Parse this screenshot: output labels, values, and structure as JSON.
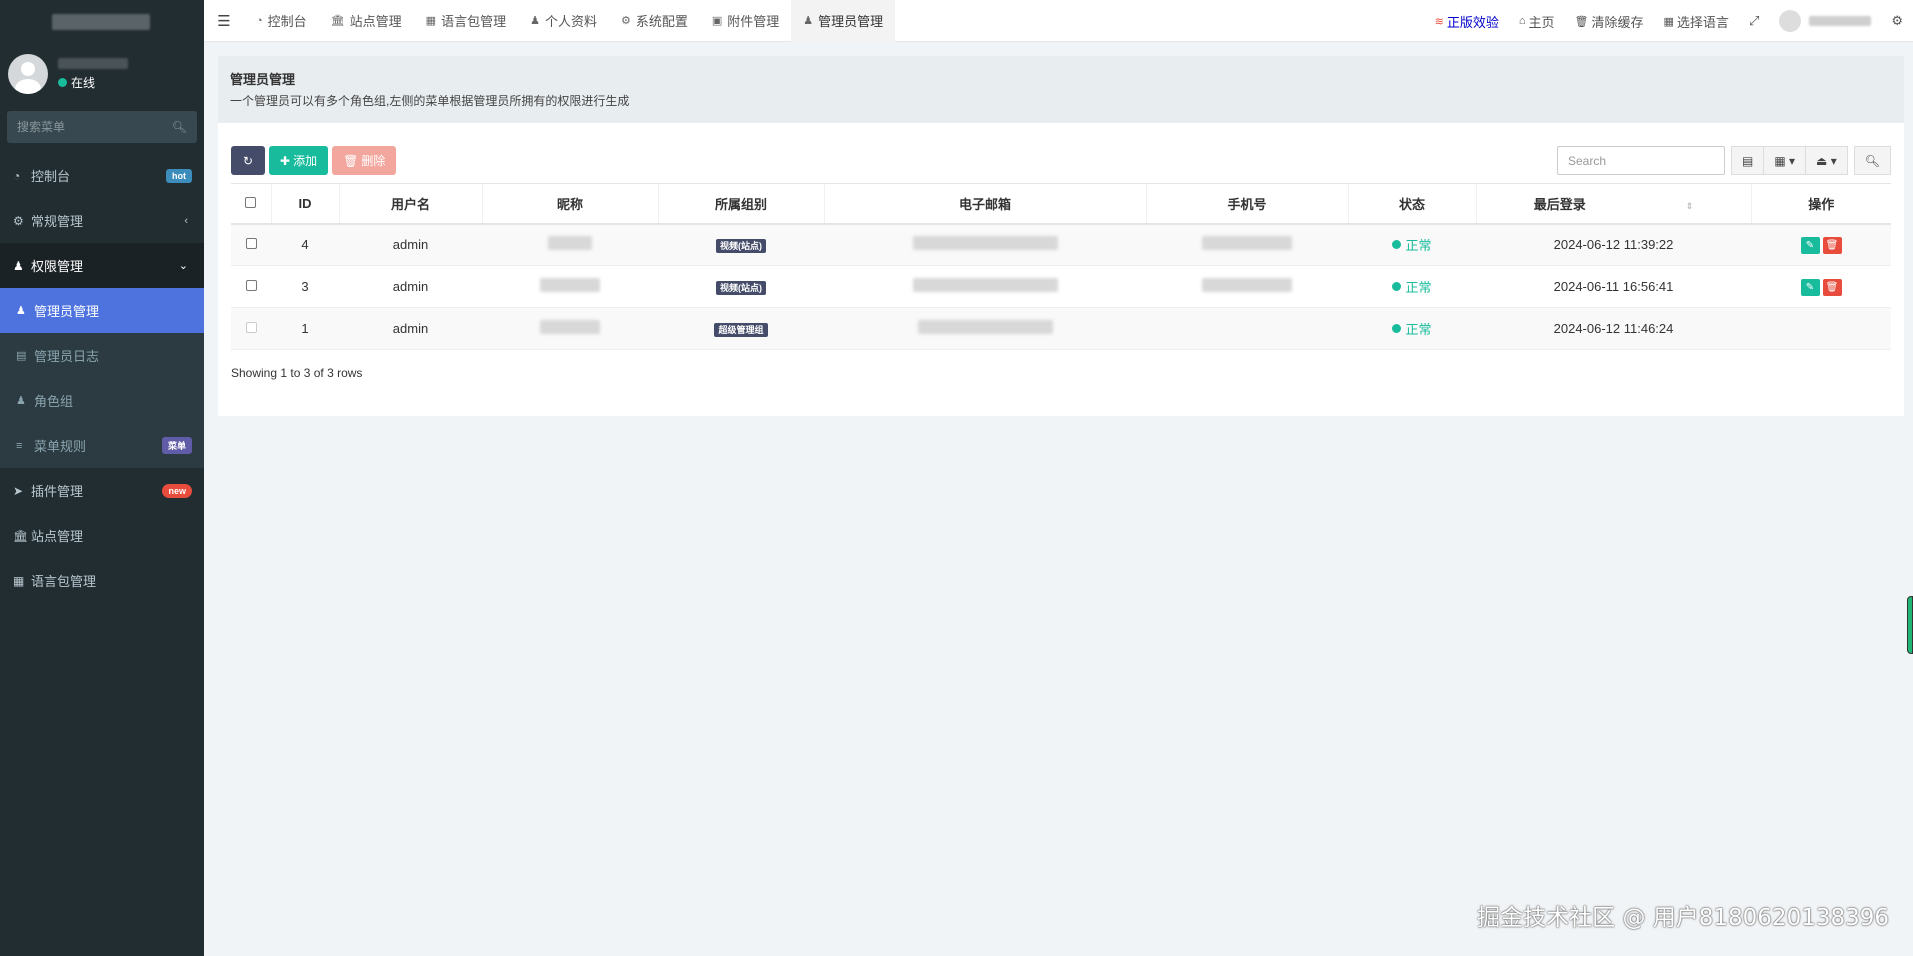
{
  "sidebar": {
    "online": "在线",
    "search_placeholder": "搜索菜单",
    "dashboard": "控制台",
    "dashboard_badge": "hot",
    "general": "常规管理",
    "auth": "权限管理",
    "auth_sub": [
      "管理员管理",
      "管理员日志",
      "角色组",
      "菜单规则"
    ],
    "menu_rule_badge": "菜单",
    "addon": "插件管理",
    "addon_badge": "new",
    "site": "站点管理",
    "lang": "语言包管理"
  },
  "topbar": {
    "tabs": [
      "控制台",
      "站点管理",
      "语言包管理",
      "个人资料",
      "系统配置",
      "附件管理",
      "管理员管理"
    ],
    "genuine": "正版效验",
    "home": "主页",
    "clear_cache": "清除缓存",
    "select_lang": "选择语言"
  },
  "panel": {
    "title": "管理员管理",
    "desc": "一个管理员可以有多个角色组,左侧的菜单根据管理员所拥有的权限进行生成"
  },
  "toolbar": {
    "add": "添加",
    "delete": "删除",
    "search_placeholder": "Search"
  },
  "table": {
    "headers": [
      "ID",
      "用户名",
      "昵称",
      "所属组别",
      "电子邮箱",
      "手机号",
      "状态",
      "最后登录",
      "操作"
    ],
    "rows": [
      {
        "id": "4",
        "username": "admin",
        "group": "视频(站点)",
        "status": "正常",
        "last_login": "2024-06-12 11:39:22"
      },
      {
        "id": "3",
        "username": "admin",
        "group": "视频(站点)",
        "status": "正常",
        "last_login": "2024-06-11 16:56:41"
      },
      {
        "id": "1",
        "username": "admin",
        "group": "超级管理组",
        "status": "正常",
        "last_login": "2024-06-12 11:46:24"
      }
    ],
    "footer": "Showing 1 to 3 of 3 rows"
  },
  "watermark": "掘金技术社区 @ 用户8180620138396",
  "colors": {
    "sidebar_bg": "#222d32",
    "active_blue": "#4e73df",
    "success": "#18bc9c",
    "danger": "#e74c3c",
    "label_dark": "#444c69"
  }
}
